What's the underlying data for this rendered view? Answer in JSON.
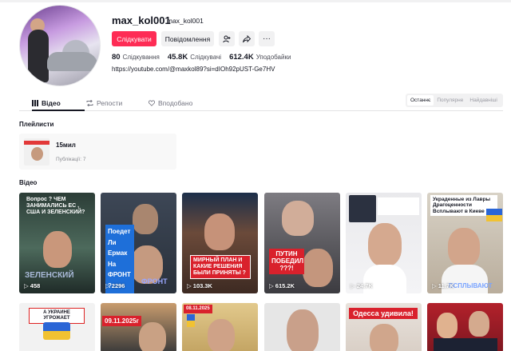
{
  "profile": {
    "username": "max_kol001",
    "nickname": "max_kol001",
    "follow_label": "Слідкувати",
    "message_label": "Повідомлення",
    "more_label": "···",
    "stats": [
      {
        "value": "80",
        "label": "Слідкування"
      },
      {
        "value": "45.8K",
        "label": "Слідкувачі"
      },
      {
        "value": "612.4K",
        "label": "Уподобайки"
      }
    ],
    "link": "https://youtube.com/@maxkol89?si=dIOh92pUST-Ge7HV"
  },
  "tabs": [
    {
      "label": "Відео",
      "icon": "grid-icon",
      "active": true
    },
    {
      "label": "Репости",
      "icon": "repost-icon",
      "active": false
    },
    {
      "label": "Вподобано",
      "icon": "heart-icon",
      "active": false
    }
  ],
  "sort_options": [
    "Останнє",
    "Популярне",
    "Найдавніші"
  ],
  "playlists": {
    "title": "Плейлисти",
    "items": [
      {
        "name": "15мил",
        "count": "Публікації: 7",
        "thumb_text": "Україна !!! ЧАЙ"
      }
    ]
  },
  "videos": {
    "title": "Відео",
    "items": [
      {
        "views": "458",
        "caption": "Вопрос ? ЧЕМ ЗАНИМАЛИСЬ ЕС , США И ЗЕЛЕНСКИЙ?",
        "overlay": "ЗЕЛЕНСКИЙ",
        "bg": "#3b5c4a"
      },
      {
        "views": "2296",
        "caption": "Поедет Ли Ермак На ФРОНТ ?",
        "overlay": "ФРОНТ",
        "bg": "#2f3642"
      },
      {
        "views": "103.3K",
        "caption": "МИРНЫЙ ПЛАН И КАКИЕ РЕШЕНИЯ БЫЛИ ПРИНЯТЫ ?",
        "overlay": "",
        "bg": "#6b4a3a"
      },
      {
        "views": "615.2K",
        "caption": "ПУТИН ПОБЕДИЛ ???!",
        "overlay": "",
        "bg": "#6f6e73"
      },
      {
        "views": "24.7K",
        "caption": "",
        "overlay": "",
        "bg": "#e9e9ec"
      },
      {
        "views": "11.7K",
        "caption": "Украденные из Лавры Драгоценности Всплывают в Киеве !",
        "overlay": "ВСПЛЫВАЮТ",
        "bg": "#c4b9a8"
      },
      {
        "views": "",
        "caption": "А УКРАИНЕ УГРОЖАЕТ",
        "overlay": "",
        "bg": "#f2f2f2"
      },
      {
        "views": "",
        "caption": "09.11.2025г",
        "overlay": "",
        "bg": "#3a3a3a"
      },
      {
        "views": "",
        "caption": "08.11.2025",
        "overlay": "",
        "bg": "#d9c9a2"
      },
      {
        "views": "",
        "caption": "",
        "overlay": "",
        "bg": "#e6e6e6"
      },
      {
        "views": "",
        "caption": "Одесса удивила!",
        "overlay": "",
        "bg": "#e8e2dc"
      },
      {
        "views": "",
        "caption": "",
        "overlay": "",
        "bg": "#b3212b"
      }
    ]
  },
  "colors": {
    "accent": "#fe2c55",
    "text": "#161823",
    "muted": "#737480"
  }
}
